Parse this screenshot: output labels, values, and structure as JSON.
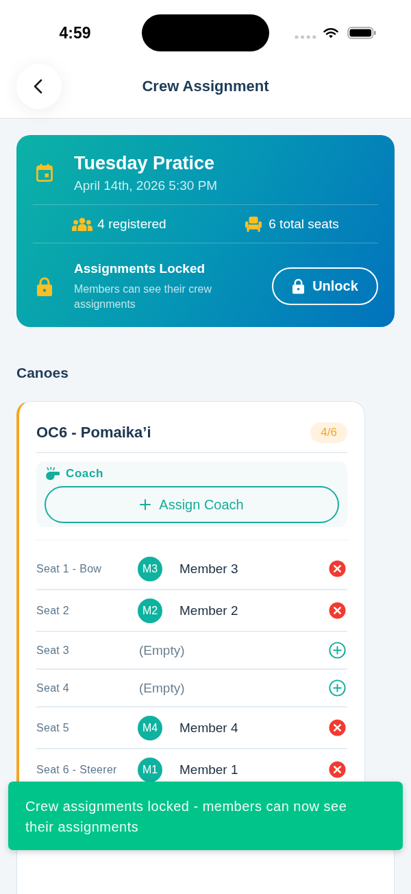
{
  "status_bar": {
    "time": "4:59"
  },
  "header": {
    "title": "Crew Assignment"
  },
  "event": {
    "title": "Tuesday Pratice",
    "datetime": "April 14th, 2026 5:30 PM",
    "stats": [
      {
        "kind": "registered",
        "text": "4 registered"
      },
      {
        "kind": "seats",
        "text": "6 total seats"
      }
    ],
    "lock": {
      "title": "Assignments Locked",
      "description": "Members can see their crew assignments",
      "button": "Unlock"
    }
  },
  "section_title": "Canoes",
  "canoes": [
    {
      "name": "OC6 - Pomaika’i",
      "count": "4/6",
      "coach": {
        "label": "Coach",
        "button": "Assign Coach"
      },
      "seats": [
        {
          "label": "Seat 1 - Bow",
          "kind": "assigned",
          "initials": "M3",
          "member": "Member 3"
        },
        {
          "label": "Seat 2",
          "kind": "assigned",
          "initials": "M2",
          "member": "Member 2"
        },
        {
          "label": "Seat 3",
          "kind": "empty",
          "member": "(Empty)"
        },
        {
          "label": "Seat 4",
          "kind": "empty",
          "member": "(Empty)"
        },
        {
          "label": "Seat 5",
          "kind": "assigned",
          "initials": "M4",
          "member": "Member 4"
        },
        {
          "label": "Seat 6 - Steerer",
          "kind": "assigned",
          "initials": "M1",
          "member": "Member 1"
        }
      ]
    }
  ],
  "toast": {
    "message": "Crew assignments locked - members can now see their assignments"
  }
}
